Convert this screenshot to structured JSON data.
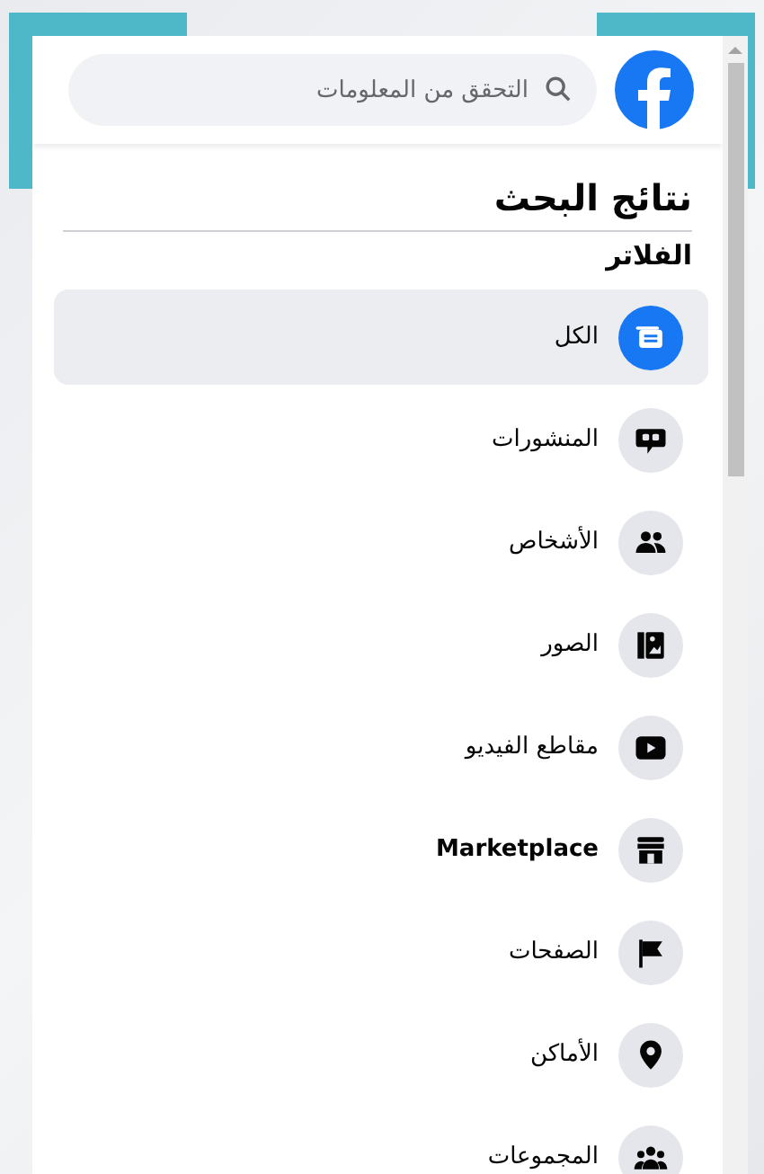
{
  "search": {
    "placeholder": "التحقق من المعلومات"
  },
  "title": "نتائج البحث",
  "filters_heading": "الفلاتر",
  "filters": [
    {
      "label": "الكل",
      "selected": true,
      "bold": false
    },
    {
      "label": "المنشورات",
      "selected": false,
      "bold": false
    },
    {
      "label": "الأشخاص",
      "selected": false,
      "bold": false
    },
    {
      "label": "الصور",
      "selected": false,
      "bold": false
    },
    {
      "label": "مقاطع الفيديو",
      "selected": false,
      "bold": false
    },
    {
      "label": "Marketplace",
      "selected": false,
      "bold": true
    },
    {
      "label": "الصفحات",
      "selected": false,
      "bold": false
    },
    {
      "label": "الأماكن",
      "selected": false,
      "bold": false
    },
    {
      "label": "المجموعات",
      "selected": false,
      "bold": false
    }
  ]
}
